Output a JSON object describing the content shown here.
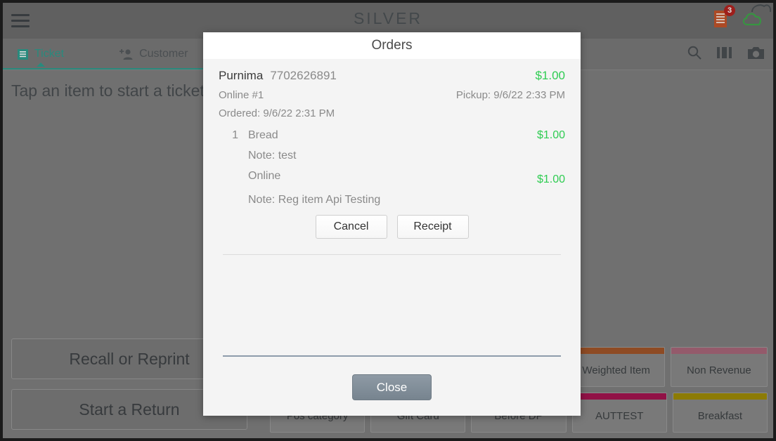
{
  "topbar": {
    "menu_icon": "hamburger-icon",
    "brand": "SILVER",
    "receipt_icon": "receipt-icon",
    "receipt_badge": "3",
    "cloud_icon": "cloud-icon"
  },
  "tabs": [
    {
      "label": "Ticket",
      "icon": "ticket-icon",
      "active": true
    },
    {
      "label": "Customer",
      "icon": "add-person-icon",
      "active": false
    }
  ],
  "tabbar_icons": [
    {
      "name": "search-icon"
    },
    {
      "name": "view-columns-icon"
    },
    {
      "name": "camera-icon"
    }
  ],
  "main": {
    "hint": "Tap an item to start a ticket",
    "buttons": [
      {
        "label": "Recall or Reprint"
      },
      {
        "label": "Start a Return"
      }
    ]
  },
  "tiles": {
    "row1": [
      {
        "label": "Weighted Item",
        "color": "#a2562a"
      },
      {
        "label": "Non Revenue",
        "color": "#a9677a"
      }
    ],
    "row2": [
      {
        "label": "Pos category",
        "color": "#8a8a8a"
      },
      {
        "label": "Gift Card",
        "color": "#8a8a8a"
      },
      {
        "label": "Before DP",
        "color": "#8a8a8a"
      },
      {
        "label": "AUTTEST",
        "color": "#a61450"
      },
      {
        "label": "Breakfast",
        "color": "#a08c06"
      }
    ]
  },
  "dialog": {
    "title": "Orders",
    "order": {
      "customer_name": "Purnima",
      "phone": "7702626891",
      "total": "$1.00",
      "channel": "Online #1",
      "pickup": "Pickup: 9/6/22 2:33 PM",
      "ordered": "Ordered: 9/6/22 2:31 PM",
      "lines": [
        {
          "qty": "1",
          "name": "Bread",
          "price": "$1.00",
          "note": "Note: test"
        },
        {
          "qty": "",
          "name": "Online",
          "price": "$1.00",
          "note": "Note: Reg item Api Testing"
        }
      ]
    },
    "cancel_label": "Cancel",
    "receipt_label": "Receipt",
    "close_label": "Close"
  },
  "colors": {
    "accent_teal": "#2f9e8f",
    "money_green": "#2fcc52",
    "badge_red": "#b4231f",
    "receipt_orange": "#c4552b",
    "cloud_green": "#3faa4a",
    "divider_blue": "#8e9bab"
  }
}
